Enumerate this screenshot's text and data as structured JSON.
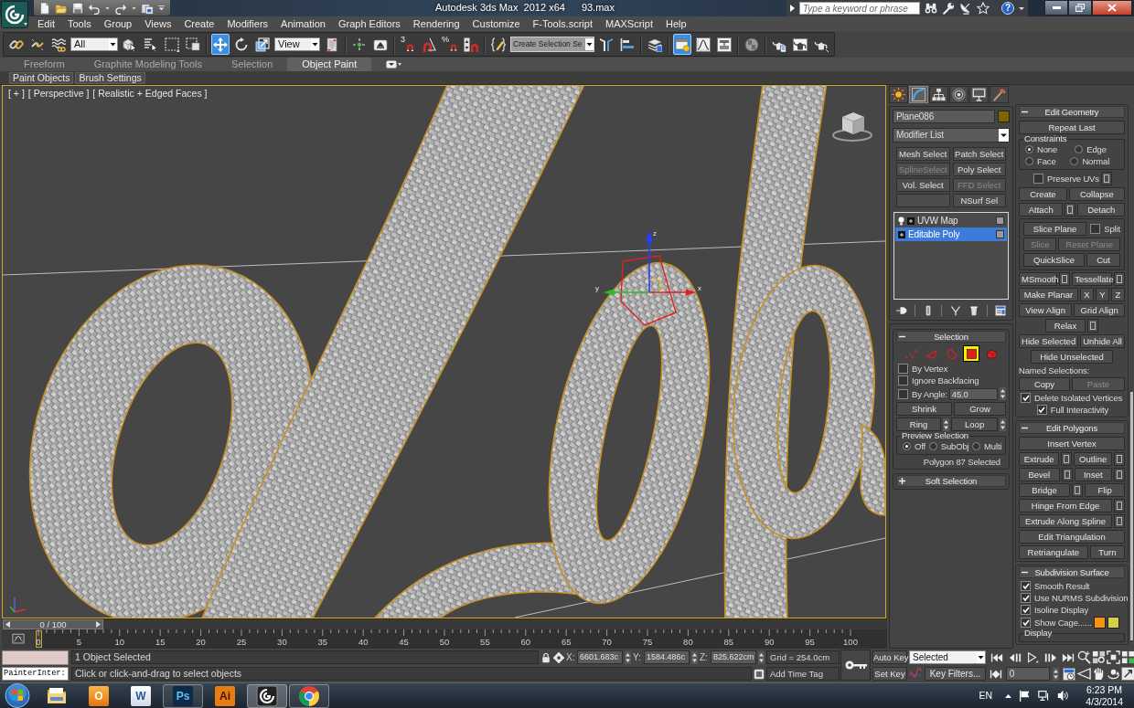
{
  "title_bar": {
    "title": "Autodesk 3ds Max  2012 x64",
    "file": "93.max",
    "search": {
      "placeholder": "Type a keyword or phrase"
    },
    "help": "?"
  },
  "menu_bar": [
    "Edit",
    "Tools",
    "Group",
    "Views",
    "Create",
    "Modifiers",
    "Animation",
    "Graph Editors",
    "Rendering",
    "Customize",
    "F-Tools.script",
    "MAXScript",
    "Help"
  ],
  "main_toolbar": [
    {
      "kind": "tool",
      "selected": false
    },
    {
      "kind": "tool",
      "selected": false
    },
    {
      "kind": "tool",
      "selected": false
    },
    {
      "kind": "dropdown",
      "value": "All"
    },
    {
      "kind": "tool",
      "selected": false
    },
    {
      "kind": "tool",
      "selected": false
    },
    {
      "kind": "tool",
      "selected": false
    },
    {
      "kind": "tool",
      "selected": false
    },
    {
      "kind": "divider"
    },
    {
      "kind": "tool",
      "selected": true
    },
    {
      "kind": "tool",
      "selected": false
    },
    {
      "kind": "tool",
      "selected": false
    },
    {
      "kind": "dropdown",
      "value": "View"
    },
    {
      "kind": "tool",
      "selected": false
    },
    {
      "kind": "divider"
    },
    {
      "kind": "tool",
      "selected": false
    },
    {
      "kind": "tool",
      "selected": false
    },
    {
      "kind": "divider"
    },
    {
      "kind": "tool",
      "selected": false,
      "glyph": "3"
    },
    {
      "kind": "tool",
      "selected": false
    },
    {
      "kind": "tool",
      "selected": false,
      "glyph": "%"
    },
    {
      "kind": "tool",
      "selected": false
    },
    {
      "kind": "divider"
    },
    {
      "kind": "tool",
      "selected": false
    },
    {
      "kind": "combo",
      "value": "Create Selection Se"
    },
    {
      "kind": "tool",
      "selected": false
    },
    {
      "kind": "tool",
      "selected": false
    },
    {
      "kind": "divider"
    },
    {
      "kind": "tool",
      "selected": false
    },
    {
      "kind": "divider"
    },
    {
      "kind": "tool",
      "selected": true
    },
    {
      "kind": "tool",
      "selected": false
    },
    {
      "kind": "tool",
      "selected": false
    },
    {
      "kind": "divider"
    },
    {
      "kind": "tool",
      "selected": false
    },
    {
      "kind": "divider"
    },
    {
      "kind": "tool",
      "selected": false
    },
    {
      "kind": "tool",
      "selected": false
    },
    {
      "kind": "tool",
      "selected": false
    }
  ],
  "ribbon": {
    "tabs": [
      {
        "label": "Freeform",
        "selected": false
      },
      {
        "label": "Graphite Modeling Tools",
        "selected": false
      },
      {
        "label": "Selection",
        "selected": false
      },
      {
        "label": "Object Paint",
        "selected": true
      }
    ],
    "panels": [
      "Paint Objects",
      "Brush Settings"
    ]
  },
  "viewport": {
    "active": true,
    "labels": [
      "[ + ]",
      "[ Perspective ]",
      "[ Realistic + Edged Faces ]"
    ],
    "gizmo_axes": [
      "z",
      "y",
      "x"
    ]
  },
  "time_slider": {
    "label": "0 / 100",
    "level": 0
  },
  "track_bar": {
    "ticks": [
      "0",
      "5",
      "10",
      "15",
      "20",
      "25",
      "30",
      "35",
      "40",
      "45",
      "50",
      "55",
      "60",
      "65",
      "70",
      "75",
      "80",
      "85",
      "90",
      "95",
      "100"
    ]
  },
  "command_panel": {
    "tabs": [
      {
        "selected": false
      },
      {
        "selected": true
      },
      {
        "selected": false
      },
      {
        "selected": false
      },
      {
        "selected": false
      },
      {
        "selected": false
      }
    ],
    "object": {
      "name": "Plane086",
      "color": "#7d6600"
    },
    "modifier_list": "Modifier List",
    "modifier_buttons": [
      {
        "kind": "button",
        "label": "Mesh Select",
        "disabled": false
      },
      {
        "kind": "button",
        "label": "Patch Select",
        "disabled": false
      },
      {
        "kind": "button",
        "label": "SplineSelect",
        "disabled": true
      },
      {
        "kind": "button",
        "label": "Poly Select",
        "disabled": false
      },
      {
        "kind": "button",
        "label": "Vol. Select",
        "disabled": false
      },
      {
        "kind": "button",
        "label": "FFD Select",
        "disabled": true
      },
      {
        "kind": "blank"
      },
      {
        "kind": "button",
        "label": "NSurf Sel",
        "disabled": false
      }
    ],
    "modifier_stack": [
      {
        "kind": "modifier",
        "label": "UVW Map",
        "selected": false
      },
      {
        "kind": "base_object",
        "label": "Editable Poly",
        "selected": true
      }
    ],
    "rollouts_left": [
      {
        "title": "Selection",
        "expanded": true,
        "rows": [
          {
            "kind": "levels",
            "levels": [
              {
                "selected": false
              },
              {
                "selected": false
              },
              {
                "selected": false
              },
              {
                "selected": true
              },
              {
                "selected": false
              }
            ]
          },
          {
            "kind": "row",
            "items": [
              {
                "kind": "checkbox",
                "label": "By Vertex",
                "checked": false
              }
            ]
          },
          {
            "kind": "row",
            "items": [
              {
                "kind": "checkbox",
                "label": "Ignore Backfacing",
                "checked": false
              }
            ]
          },
          {
            "kind": "row",
            "items": [
              {
                "kind": "checkbox",
                "label": "By Angle:",
                "checked": false
              },
              {
                "kind": "number_field",
                "value": "45.0"
              }
            ]
          },
          {
            "kind": "row",
            "items": [
              {
                "kind": "button",
                "label": "Shrink",
                "disabled": false
              },
              {
                "kind": "button",
                "label": "Grow",
                "disabled": false
              }
            ]
          },
          {
            "kind": "row",
            "items": [
              {
                "kind": "button",
                "label": "Ring",
                "disabled": false
              },
              {
                "kind": "spinner"
              },
              {
                "kind": "button",
                "label": "Loop",
                "disabled": false
              },
              {
                "kind": "spinner"
              }
            ]
          },
          {
            "kind": "group",
            "title": "Preview Selection",
            "rows": [
              {
                "kind": "row",
                "items": [
                  {
                    "kind": "radio",
                    "label": "Off",
                    "selected": true
                  },
                  {
                    "kind": "radio",
                    "label": "SubObj",
                    "selected": false
                  },
                  {
                    "kind": "radio",
                    "label": "Multi",
                    "selected": false
                  }
                ]
              }
            ]
          },
          {
            "kind": "right",
            "items": [
              {
                "kind": "text",
                "label": "Polygon 87 Selected"
              }
            ]
          }
        ]
      },
      {
        "title": "Soft Selection",
        "expanded": false
      }
    ],
    "rollouts_right": [
      {
        "title": "Edit Geometry",
        "expanded": true,
        "rows": [
          {
            "kind": "row",
            "items": [
              {
                "kind": "button",
                "label": "Repeat Last",
                "disabled": false
              }
            ]
          },
          {
            "kind": "group",
            "title": "Constraints",
            "rows": [
              {
                "kind": "row",
                "items": [
                  {
                    "kind": "radio",
                    "label": "None",
                    "selected": true
                  },
                  {
                    "kind": "radio",
                    "label": "Edge",
                    "selected": false
                  }
                ]
              },
              {
                "kind": "row",
                "items": [
                  {
                    "kind": "radio",
                    "label": "Face",
                    "selected": false
                  },
                  {
                    "kind": "radio",
                    "label": "Normal",
                    "selected": false
                  }
                ]
              }
            ]
          },
          {
            "kind": "center",
            "items": [
              {
                "kind": "checkbox",
                "label": "Preserve UVs",
                "checked": false
              },
              {
                "kind": "settings"
              }
            ]
          },
          {
            "kind": "row",
            "items": [
              {
                "kind": "button",
                "label": "Create",
                "disabled": false
              },
              {
                "kind": "button",
                "label": "Collapse",
                "disabled": false
              }
            ]
          },
          {
            "kind": "row",
            "items": [
              {
                "kind": "button",
                "label": "Attach",
                "disabled": false
              },
              {
                "kind": "settings"
              },
              {
                "kind": "button",
                "label": "Detach",
                "disabled": false
              }
            ]
          },
          {
            "kind": "group",
            "rows": [
              {
                "kind": "row",
                "items": [
                  {
                    "kind": "button",
                    "label": "Slice Plane",
                    "disabled": false
                  },
                  {
                    "kind": "checkbox",
                    "label": "Split",
                    "checked": false
                  }
                ]
              },
              {
                "kind": "row",
                "items": [
                  {
                    "kind": "button",
                    "label": "Slice",
                    "disabled": true
                  },
                  {
                    "kind": "button",
                    "label": "Reset Plane",
                    "disabled": true
                  }
                ]
              },
              {
                "kind": "row",
                "items": [
                  {
                    "kind": "button",
                    "label": "QuickSlice",
                    "disabled": false
                  },
                  {
                    "kind": "button",
                    "label": "Cut",
                    "disabled": false
                  }
                ]
              }
            ]
          },
          {
            "kind": "row",
            "items": [
              {
                "kind": "button",
                "label": "MSmooth",
                "disabled": false
              },
              {
                "kind": "settings"
              },
              {
                "kind": "button",
                "label": "Tessellate",
                "disabled": false
              },
              {
                "kind": "settings"
              }
            ]
          },
          {
            "kind": "row",
            "items": [
              {
                "kind": "button",
                "label": "Make Planar",
                "disabled": false
              },
              {
                "kind": "axis_button",
                "label": "X"
              },
              {
                "kind": "axis_button",
                "label": "Y"
              },
              {
                "kind": "axis_button",
                "label": "Z"
              }
            ]
          },
          {
            "kind": "row",
            "items": [
              {
                "kind": "button",
                "label": "View Align",
                "disabled": false
              },
              {
                "kind": "button",
                "label": "Grid Align",
                "disabled": false
              }
            ]
          },
          {
            "kind": "center",
            "items": [
              {
                "kind": "button",
                "label": "Relax",
                "disabled": false
              },
              {
                "kind": "settings"
              }
            ]
          },
          {
            "kind": "row",
            "items": [
              {
                "kind": "button",
                "label": "Hide Selected",
                "disabled": false
              },
              {
                "kind": "button",
                "label": "Unhide All",
                "disabled": false
              }
            ]
          },
          {
            "kind": "center",
            "items": [
              {
                "kind": "button",
                "label": "Hide Unselected",
                "disabled": false
              }
            ]
          },
          {
            "kind": "row",
            "items": [
              {
                "kind": "text",
                "label": "Named Selections:"
              }
            ]
          },
          {
            "kind": "row",
            "items": [
              {
                "kind": "button",
                "label": "Copy",
                "disabled": false
              },
              {
                "kind": "button",
                "label": "Paste",
                "disabled": true
              }
            ]
          },
          {
            "kind": "row",
            "items": [
              {
                "kind": "checkbox",
                "label": "Delete Isolated Vertices",
                "checked": true
              }
            ]
          },
          {
            "kind": "center",
            "items": [
              {
                "kind": "checkbox",
                "label": "Full Interactivity",
                "checked": true
              }
            ]
          }
        ]
      },
      {
        "title": "Edit Polygons",
        "expanded": true,
        "rows": [
          {
            "kind": "row",
            "items": [
              {
                "kind": "button",
                "label": "Insert Vertex",
                "disabled": false
              }
            ]
          },
          {
            "kind": "row",
            "items": [
              {
                "kind": "button",
                "label": "Extrude",
                "disabled": false
              },
              {
                "kind": "settings"
              },
              {
                "kind": "button",
                "label": "Outline",
                "disabled": false
              },
              {
                "kind": "settings"
              }
            ]
          },
          {
            "kind": "row",
            "items": [
              {
                "kind": "button",
                "label": "Bevel",
                "disabled": false
              },
              {
                "kind": "settings"
              },
              {
                "kind": "button",
                "label": "Inset",
                "disabled": false
              },
              {
                "kind": "settings"
              }
            ]
          },
          {
            "kind": "row",
            "items": [
              {
                "kind": "button",
                "label": "Bridge",
                "disabled": false
              },
              {
                "kind": "settings"
              },
              {
                "kind": "button",
                "label": "Flip",
                "disabled": false
              }
            ]
          },
          {
            "kind": "row",
            "items": [
              {
                "kind": "button",
                "label": "Hinge From Edge",
                "disabled": false
              },
              {
                "kind": "settings"
              }
            ]
          },
          {
            "kind": "row",
            "items": [
              {
                "kind": "button",
                "label": "Extrude Along Spline",
                "disabled": false
              },
              {
                "kind": "settings"
              }
            ]
          },
          {
            "kind": "row",
            "items": [
              {
                "kind": "button",
                "label": "Edit Triangulation",
                "disabled": false
              }
            ]
          },
          {
            "kind": "row",
            "items": [
              {
                "kind": "button",
                "label": "Retriangulate",
                "disabled": false
              },
              {
                "kind": "button",
                "label": "Turn",
                "disabled": false
              }
            ]
          }
        ]
      },
      {
        "title": "Subdivision Surface",
        "expanded": true,
        "rows": [
          {
            "kind": "row",
            "items": [
              {
                "kind": "checkbox",
                "label": "Smooth Result",
                "checked": true
              }
            ]
          },
          {
            "kind": "row",
            "items": [
              {
                "kind": "checkbox",
                "label": "Use NURMS Subdivision",
                "checked": true
              }
            ]
          },
          {
            "kind": "row",
            "items": [
              {
                "kind": "checkbox",
                "label": "Isoline Display",
                "checked": true
              }
            ]
          },
          {
            "kind": "row",
            "items": [
              {
                "kind": "checkbox",
                "label": "Show Cage......",
                "checked": true
              },
              {
                "kind": "swatch",
                "color": "#f7930e"
              },
              {
                "kind": "swatch",
                "color": "#d3d049"
              }
            ]
          },
          {
            "kind": "group",
            "title": "Display"
          }
        ]
      }
    ]
  },
  "status_bar": {
    "listener_output": "PainterInter:",
    "selection_info": "1 Object Selected",
    "prompt": "Click or click-and-drag to select objects",
    "coordinates": [
      {
        "axis": "X:",
        "value": "6601.683c"
      },
      {
        "axis": "Y:",
        "value": "1584.486c"
      },
      {
        "axis": "Z:",
        "value": "825.622cm"
      }
    ],
    "grid": "Grid = 254.0cm",
    "time_tag": "Add Time Tag"
  },
  "animation_controls": {
    "auto_key": {
      "label": "Auto Key",
      "on": false
    },
    "set_key": "Set Key",
    "key_mode": "Selected",
    "key_filters": "Key Filters...",
    "current_frame": "0"
  },
  "taskbar": {
    "apps": [
      {
        "running": false,
        "selected": false
      },
      {
        "running": false,
        "selected": false,
        "icon_text": "O"
      },
      {
        "running": false,
        "selected": false,
        "icon_text": "W"
      },
      {
        "running": true,
        "selected": false,
        "icon_text": "Ps"
      },
      {
        "running": false,
        "selected": false,
        "icon_text": "Ai"
      },
      {
        "running": true,
        "selected": true
      },
      {
        "running": true,
        "selected": false
      }
    ],
    "tray": {
      "language": "EN",
      "time": "6:23 PM",
      "date": "4/3/2014"
    }
  }
}
